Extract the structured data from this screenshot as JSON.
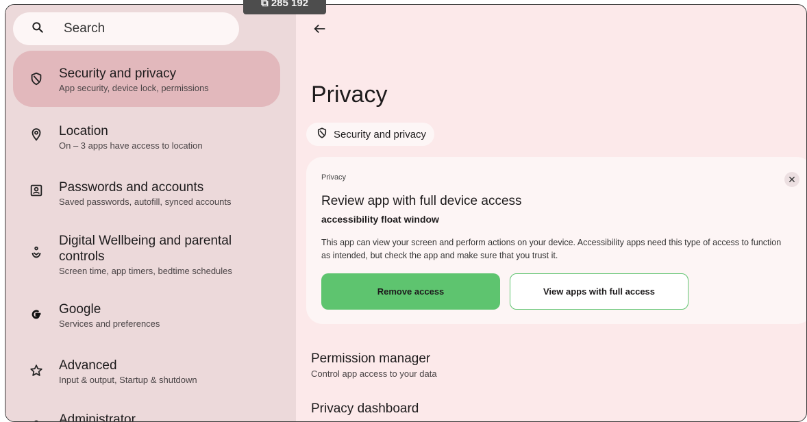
{
  "search": {
    "placeholder": "Search"
  },
  "sidebar": {
    "items": [
      {
        "title": "Security and privacy",
        "subtitle": "App security, device lock, permissions",
        "icon": "shield-icon",
        "active": true
      },
      {
        "title": "Location",
        "subtitle": "On – 3 apps have access to location",
        "icon": "location-pin-icon"
      },
      {
        "title": "Passwords and accounts",
        "subtitle": "Saved passwords, autofill, synced accounts",
        "icon": "account-box-icon"
      },
      {
        "title": "Digital Wellbeing and parental controls",
        "subtitle": "Screen time, app timers, bedtime schedules",
        "icon": "wellbeing-icon"
      },
      {
        "title": "Google",
        "subtitle": "Services and preferences",
        "icon": "google-icon"
      },
      {
        "title": "Advanced",
        "subtitle": "Input & output, Startup & shutdown",
        "icon": "star-icon"
      },
      {
        "title": "Administrator",
        "subtitle": "",
        "icon": "admin-icon"
      }
    ]
  },
  "main": {
    "title": "Privacy",
    "chip_label": "Security and privacy",
    "card": {
      "kicker": "Privacy",
      "title": "Review app with full device access",
      "app_name": "accessibility float window",
      "body": "This app can view your screen and perform actions on your device. Accessibility apps need this type of access to function as intended, but check the app and make sure that you trust it.",
      "primary_button": "Remove access",
      "secondary_button": "View apps with full access"
    },
    "list": [
      {
        "title": "Permission manager",
        "subtitle": "Control app access to your data"
      },
      {
        "title": "Privacy dashboard",
        "subtitle": ""
      }
    ]
  },
  "overlay": {
    "text": "⧉ 285 192"
  },
  "colors": {
    "accent": "#5ec46f",
    "sidebar_bg": "#ecd9da",
    "active_item": "#e2b8bc",
    "page_bg": "#fce9ea"
  }
}
